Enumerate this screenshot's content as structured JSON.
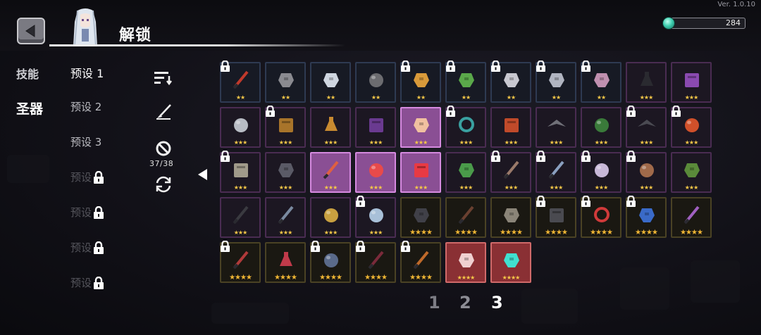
{
  "version": "Ver. 1.0.10",
  "header": {
    "title": "解锁",
    "gem_count": "284"
  },
  "tabs": [
    {
      "label": "技能",
      "active": false
    },
    {
      "label": "圣器",
      "active": true
    }
  ],
  "presets": [
    {
      "label": "预设 1",
      "state": "active"
    },
    {
      "label": "预设 2",
      "state": "normal"
    },
    {
      "label": "预设 3",
      "state": "normal"
    },
    {
      "label": "预设",
      "state": "locked"
    },
    {
      "label": "预设",
      "state": "locked"
    },
    {
      "label": "预设",
      "state": "locked"
    },
    {
      "label": "预设",
      "state": "locked"
    }
  ],
  "tools": {
    "disabled_count": "37/38",
    "icons": [
      "sort-icon",
      "brush-icon",
      "disable-icon",
      "cycle-icon"
    ]
  },
  "pagination": {
    "pages": [
      "1",
      "2",
      "3"
    ],
    "current": "3"
  },
  "colors": {
    "common_border": "#2e3a52",
    "rare_border": "#4a2c52",
    "epic_border": "#4a4224",
    "selected": "#8a4f94",
    "highlight_red": "#8a3034",
    "star": "#f6c848"
  },
  "items": [
    {
      "name": "crossed-blades",
      "stars": 2,
      "frame": "b",
      "lock": true,
      "color": "#c0392b"
    },
    {
      "name": "gauntlet",
      "stars": 2,
      "frame": "b",
      "lock": false,
      "color": "#8a8a90"
    },
    {
      "name": "apple",
      "stars": 2,
      "frame": "b",
      "lock": false,
      "color": "#cfd6e0"
    },
    {
      "name": "stone-orb",
      "stars": 2,
      "frame": "b",
      "lock": false,
      "color": "#6c6c70"
    },
    {
      "name": "medal",
      "stars": 2,
      "frame": "b",
      "lock": true,
      "color": "#d99a3a"
    },
    {
      "name": "green-leaf",
      "stars": 2,
      "frame": "b",
      "lock": true,
      "color": "#5aa84a"
    },
    {
      "name": "feather",
      "stars": 2,
      "frame": "b",
      "lock": true,
      "color": "#c8c8d0"
    },
    {
      "name": "ghost-wisp",
      "stars": 2,
      "frame": "b",
      "lock": true,
      "color": "#b0b4c0"
    },
    {
      "name": "crystal-cluster",
      "stars": 2,
      "frame": "b",
      "lock": true,
      "color": "#c090b0"
    },
    {
      "name": "dark-flask",
      "stars": 3,
      "frame": "p",
      "lock": false,
      "color": "#2a2a30"
    },
    {
      "name": "purple-tome",
      "stars": 3,
      "frame": "p",
      "lock": false,
      "color": "#8a4ab0"
    },
    {
      "name": "grey-rock",
      "stars": 3,
      "frame": "p",
      "lock": false,
      "color": "#b8bcc4"
    },
    {
      "name": "wood-box",
      "stars": 3,
      "frame": "p",
      "lock": true,
      "color": "#a8742a"
    },
    {
      "name": "golden-chalice",
      "stars": 3,
      "frame": "p",
      "lock": false,
      "color": "#c88a30"
    },
    {
      "name": "violet-book",
      "stars": 3,
      "frame": "p",
      "lock": false,
      "color": "#6a3a90"
    },
    {
      "name": "pink-helmet",
      "stars": 3,
      "frame": "sel",
      "lock": false,
      "color": "#f0c0a0"
    },
    {
      "name": "syringe",
      "stars": 3,
      "frame": "p",
      "lock": true,
      "color": "#3aa0a0"
    },
    {
      "name": "red-shield",
      "stars": 3,
      "frame": "p",
      "lock": false,
      "color": "#c04a2a"
    },
    {
      "name": "iron-cross",
      "stars": 3,
      "frame": "p",
      "lock": false,
      "color": "#707078"
    },
    {
      "name": "green-pouch",
      "stars": 3,
      "frame": "p",
      "lock": false,
      "color": "#3a7a3a"
    },
    {
      "name": "bat-wings",
      "stars": 3,
      "frame": "p",
      "lock": true,
      "color": "#4a4a52"
    },
    {
      "name": "fire-orb",
      "stars": 3,
      "frame": "p",
      "lock": true,
      "color": "#d0502a"
    },
    {
      "name": "scroll-map",
      "stars": 3,
      "frame": "p",
      "lock": true,
      "color": "#a09a8a"
    },
    {
      "name": "spyglass",
      "stars": 3,
      "frame": "p",
      "lock": false,
      "color": "#5a5a66"
    },
    {
      "name": "flame-torch",
      "stars": 3,
      "frame": "sel",
      "lock": false,
      "color": "#e06040"
    },
    {
      "name": "red-egg",
      "stars": 3,
      "frame": "sel",
      "lock": false,
      "color": "#e84a4a"
    },
    {
      "name": "first-aid-kit",
      "stars": 3,
      "frame": "sel",
      "lock": false,
      "color": "#e83a44"
    },
    {
      "name": "green-mask",
      "stars": 3,
      "frame": "p",
      "lock": false,
      "color": "#4a9a4a"
    },
    {
      "name": "quill-brush",
      "stars": 3,
      "frame": "p",
      "lock": true,
      "color": "#9a7a6a"
    },
    {
      "name": "antler-branch",
      "stars": 3,
      "frame": "p",
      "lock": true,
      "color": "#8aa0c0"
    },
    {
      "name": "crescent-moon",
      "stars": 3,
      "frame": "p",
      "lock": true,
      "color": "#c8b8d8"
    },
    {
      "name": "fur-pouch",
      "stars": 3,
      "frame": "p",
      "lock": true,
      "color": "#a06a4a"
    },
    {
      "name": "leaf-cloak",
      "stars": 3,
      "frame": "p",
      "lock": false,
      "color": "#5a8a3a"
    },
    {
      "name": "black-spear",
      "stars": 3,
      "frame": "p",
      "lock": false,
      "color": "#3a3a40"
    },
    {
      "name": "thorn-vine",
      "stars": 3,
      "frame": "p",
      "lock": false,
      "color": "#7a8aa0"
    },
    {
      "name": "gold-nugget",
      "stars": 3,
      "frame": "p",
      "lock": false,
      "color": "#c8a040"
    },
    {
      "name": "cloud-swirl",
      "stars": 3,
      "frame": "p",
      "lock": true,
      "color": "#a8c0d8"
    },
    {
      "name": "black-gauntlet",
      "stars": 4,
      "frame": "y",
      "lock": false,
      "color": "#404048"
    },
    {
      "name": "bone-branch",
      "stars": 4,
      "frame": "y",
      "lock": false,
      "color": "#6a4030"
    },
    {
      "name": "skull-mask",
      "stars": 4,
      "frame": "y",
      "lock": false,
      "color": "#8a8478"
    },
    {
      "name": "dark-barrel",
      "stars": 4,
      "frame": "y",
      "lock": true,
      "color": "#4a4a50"
    },
    {
      "name": "red-ring",
      "stars": 4,
      "frame": "y",
      "lock": true,
      "color": "#d03a3a"
    },
    {
      "name": "blue-anvil",
      "stars": 4,
      "frame": "y",
      "lock": true,
      "color": "#3a6ac8"
    },
    {
      "name": "purple-blade",
      "stars": 4,
      "frame": "y",
      "lock": false,
      "color": "#a060c0"
    },
    {
      "name": "red-dagger",
      "stars": 4,
      "frame": "y",
      "lock": true,
      "color": "#b03a3a"
    },
    {
      "name": "red-potion",
      "stars": 4,
      "frame": "y",
      "lock": false,
      "color": "#c03a4a"
    },
    {
      "name": "dark-globe",
      "stars": 4,
      "frame": "y",
      "lock": true,
      "color": "#5a6a8a"
    },
    {
      "name": "crimson-staff",
      "stars": 4,
      "frame": "y",
      "lock": true,
      "color": "#7a2a3a"
    },
    {
      "name": "flame-sword",
      "stars": 4,
      "frame": "y",
      "lock": true,
      "color": "#c06a2a"
    },
    {
      "name": "red-crystal-shard",
      "stars": 4,
      "frame": "red",
      "lock": false,
      "color": "#f0d0d0"
    },
    {
      "name": "cyan-spirit-flame",
      "stars": 4,
      "frame": "red",
      "lock": false,
      "color": "#40e0d0"
    }
  ]
}
